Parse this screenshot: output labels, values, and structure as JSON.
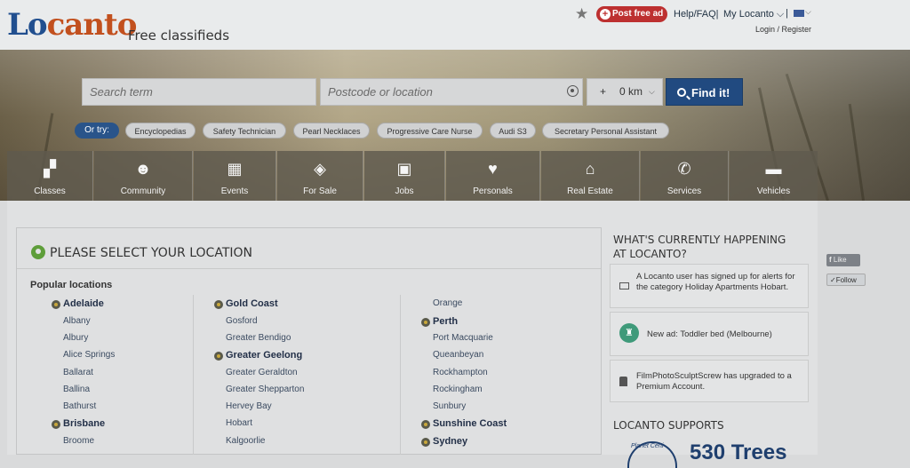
{
  "header": {
    "logo": {
      "part1": "Lo",
      "part2": "canto"
    },
    "tagline": "Free classifieds",
    "post_ad": "Post free ad",
    "help": "Help/FAQ|",
    "my_locanto": "My Locanto ⌵",
    "separator": "|",
    "login": "Login / Register"
  },
  "search": {
    "term_placeholder": "Search term",
    "location_placeholder": "Postcode or location",
    "radius_plus": "+",
    "radius_value": "0 km",
    "find_label": "Find it!"
  },
  "suggestions": {
    "or_try": "Or try:",
    "items": [
      "Encyclopedias",
      "Safety Technician",
      "Pearl Necklaces",
      "Progressive Care Nurse",
      "Audi S3",
      "Secretary Personal Assistant"
    ]
  },
  "categories": [
    {
      "label": "Classes",
      "icon": "presentation-icon"
    },
    {
      "label": "Community",
      "icon": "people-icon"
    },
    {
      "label": "Events",
      "icon": "calendar-icon"
    },
    {
      "label": "For Sale",
      "icon": "tag-icon"
    },
    {
      "label": "Jobs",
      "icon": "briefcase-icon"
    },
    {
      "label": "Personals",
      "icon": "heart-icon"
    },
    {
      "label": "Real Estate",
      "icon": "house-icon"
    },
    {
      "label": "Services",
      "icon": "phone-icon"
    },
    {
      "label": "Vehicles",
      "icon": "car-icon"
    }
  ],
  "location_panel": {
    "title": "PLEASE SELECT YOUR LOCATION",
    "popular": "Popular locations",
    "col1": [
      {
        "name": "Adelaide",
        "major": true
      },
      {
        "name": "Albany",
        "major": false
      },
      {
        "name": "Albury",
        "major": false
      },
      {
        "name": "Alice Springs",
        "major": false
      },
      {
        "name": "Ballarat",
        "major": false
      },
      {
        "name": "Ballina",
        "major": false
      },
      {
        "name": "Bathurst",
        "major": false
      },
      {
        "name": "Brisbane",
        "major": true
      },
      {
        "name": "Broome",
        "major": false
      }
    ],
    "col2": [
      {
        "name": "Gold Coast",
        "major": true
      },
      {
        "name": "Gosford",
        "major": false
      },
      {
        "name": "Greater Bendigo",
        "major": false
      },
      {
        "name": "Greater Geelong",
        "major": true
      },
      {
        "name": "Greater Geraldton",
        "major": false
      },
      {
        "name": "Greater Shepparton",
        "major": false
      },
      {
        "name": "Hervey Bay",
        "major": false
      },
      {
        "name": "Hobart",
        "major": false
      },
      {
        "name": "Kalgoorlie",
        "major": false
      }
    ],
    "col3": [
      {
        "name": "Orange",
        "major": false
      },
      {
        "name": "Perth",
        "major": true
      },
      {
        "name": "Port Macquarie",
        "major": false
      },
      {
        "name": "Queanbeyan",
        "major": false
      },
      {
        "name": "Rockhampton",
        "major": false
      },
      {
        "name": "Rockingham",
        "major": false
      },
      {
        "name": "Sunbury",
        "major": false
      },
      {
        "name": "Sunshine Coast",
        "major": true
      },
      {
        "name": "Sydney",
        "major": true
      }
    ]
  },
  "sidebar": {
    "happening_title": "WHAT'S CURRENTLY HAPPENING AT LOCANTO?",
    "feed": [
      "A Locanto user has signed up for alerts for the category Holiday Apartments Hobart.",
      "New ad: Toddler bed (Melbourne)",
      "FilmPhotoSculptScrew has upgraded to a Premium Account."
    ],
    "supports_title": "LOCANTO SUPPORTS",
    "trees": "530 Trees",
    "planet": "Planet Certi"
  },
  "social": {
    "like": "Like",
    "follow": "Follow"
  }
}
